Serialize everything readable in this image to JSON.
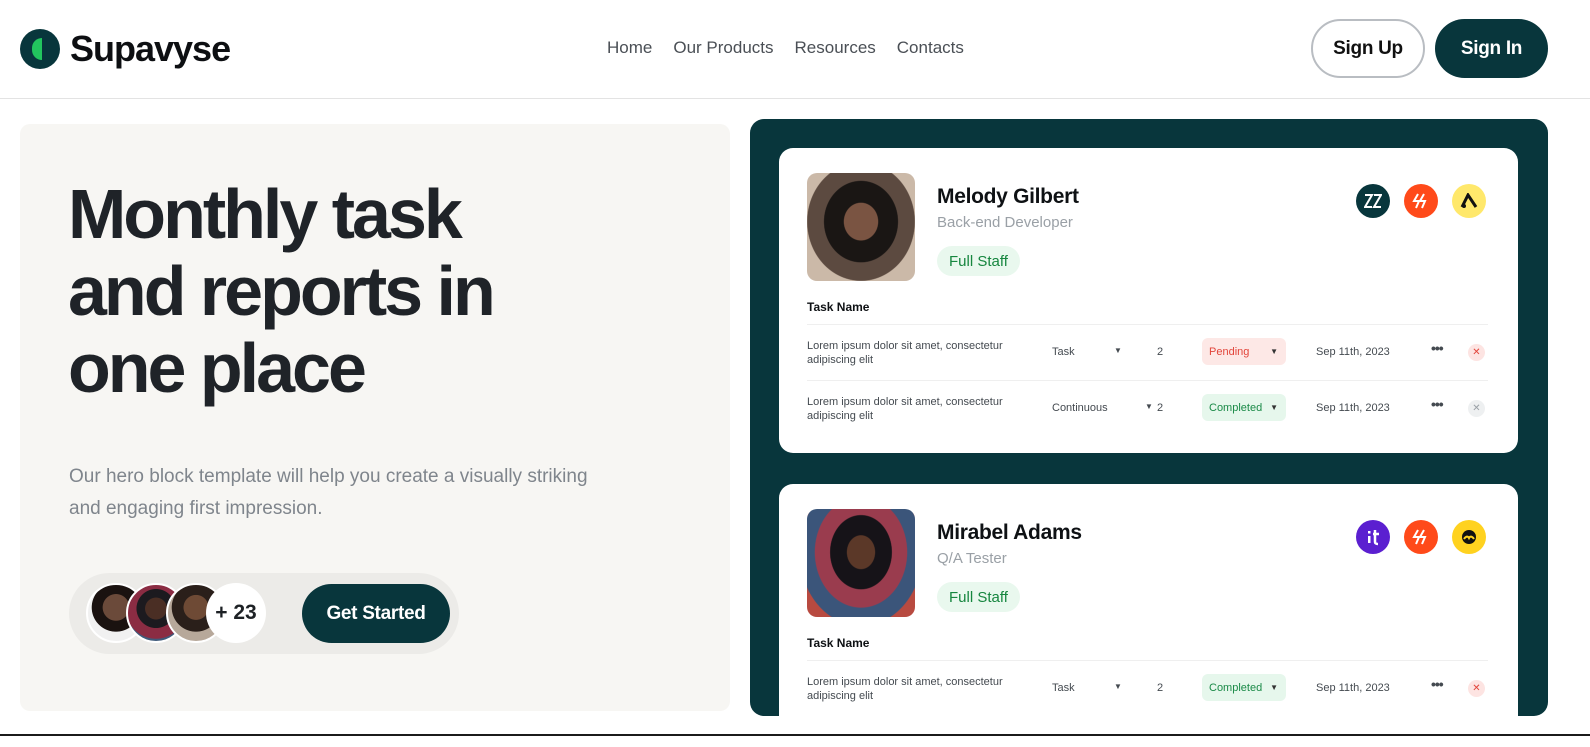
{
  "brand": {
    "name": "Supavyse"
  },
  "nav": {
    "items": [
      "Home",
      "Our Products",
      "Resources",
      "Contacts"
    ]
  },
  "auth": {
    "signup_label": "Sign Up",
    "signin_label": "Sign In"
  },
  "hero": {
    "title_lines": [
      "Monthly task",
      "and reports in",
      "one place"
    ],
    "subtitle_lines": [
      "Our hero block template will help you create a visually striking",
      "and engaging first impression."
    ],
    "avatar_count": "+ 23",
    "cta_label": "Get Started"
  },
  "cards": [
    {
      "name": "Melody Gilbert",
      "role": "Back-end Developer",
      "badge": "Full Staff",
      "icons": [
        "zendesk-icon",
        "hubspot-icon",
        "archive-a-icon"
      ],
      "task_header": "Task Name",
      "tasks": [
        {
          "desc_lines": [
            "Lorem ipsum dolor sit amet, consectetur",
            "adipiscing elit"
          ],
          "type": "Task",
          "count": "2",
          "status": "Pending",
          "date": "Sep 11th, 2023"
        },
        {
          "desc_lines": [
            "Lorem ipsum dolor sit amet, consectetur",
            "adipiscing elit"
          ],
          "type": "Continuous",
          "count": "2",
          "status": "Completed",
          "date": "Sep 11th, 2023"
        }
      ]
    },
    {
      "name": "Mirabel Adams",
      "role": "Q/A Tester",
      "badge": "Full Staff",
      "icons": [
        "tt-icon",
        "hubspot-icon",
        "basecamp-icon"
      ],
      "task_header": "Task Name",
      "tasks": [
        {
          "desc_lines": [
            "Lorem ipsum dolor sit amet, consectetur",
            "adipiscing elit"
          ],
          "type": "Task",
          "count": "2",
          "status": "Completed",
          "date": "Sep 11th, 2023"
        }
      ]
    }
  ],
  "colors": {
    "brand_dark": "#08363c",
    "accent_green": "#22c55e",
    "pending_red": "#e2453b",
    "completed_green": "#1a8a47"
  }
}
